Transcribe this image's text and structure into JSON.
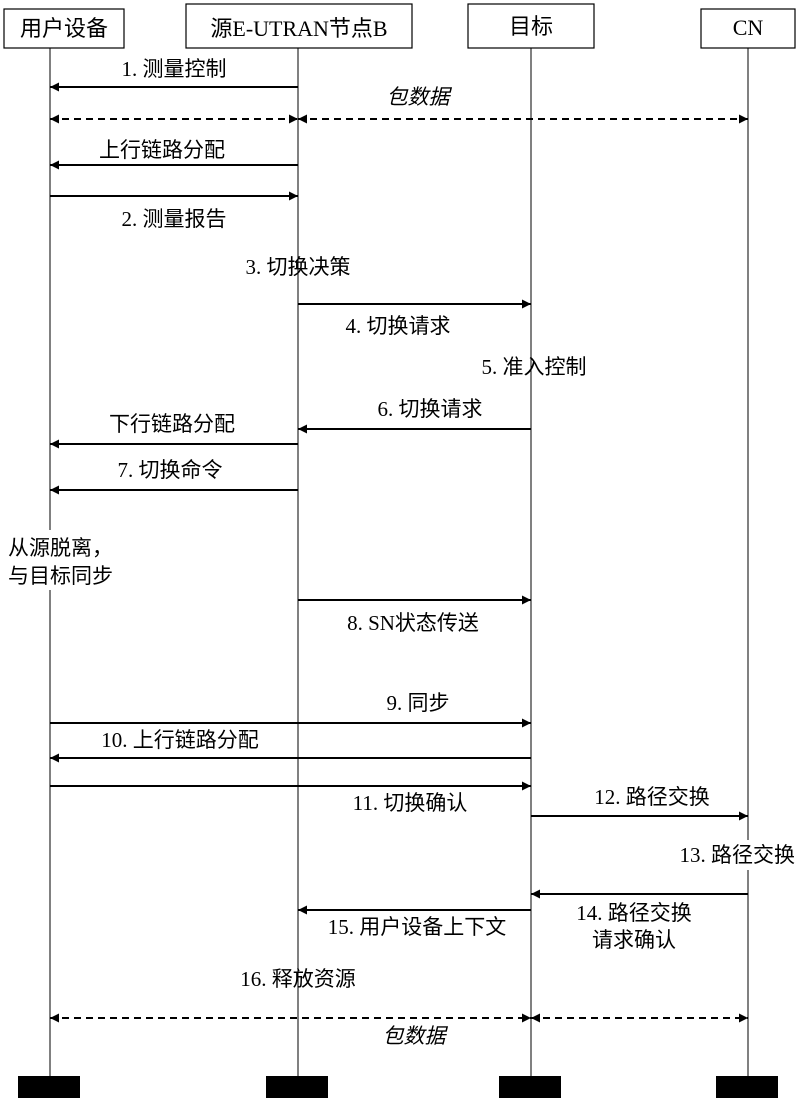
{
  "participants": [
    {
      "id": "ue",
      "label": "用户设备"
    },
    {
      "id": "src",
      "label": "源E-UTRAN节点B"
    },
    {
      "id": "tgt",
      "label": "目标"
    },
    {
      "id": "cn",
      "label": "CN"
    }
  ],
  "messages": [
    {
      "id": "m1",
      "label": "1. 测量控制",
      "from": "src",
      "to": "ue",
      "style": "solid"
    },
    {
      "id": "pd1a",
      "label": "",
      "from": "ue",
      "to": "src",
      "style": "dashed-both"
    },
    {
      "id": "pd1b",
      "label": "包数据",
      "from": "src",
      "to": "cn",
      "style": "dashed-both"
    },
    {
      "id": "ul1",
      "label": "上行链路分配",
      "from": "src",
      "to": "ue",
      "style": "solid"
    },
    {
      "id": "m2",
      "label": "2. 测量报告",
      "from": "ue",
      "to": "src",
      "style": "solid"
    },
    {
      "id": "m4",
      "label": "4. 切换请求",
      "from": "src",
      "to": "tgt",
      "style": "solid"
    },
    {
      "id": "m6",
      "label": "6. 切换请求",
      "from": "tgt",
      "to": "src",
      "style": "solid"
    },
    {
      "id": "dl",
      "label": "下行链路分配",
      "from": "src",
      "to": "ue",
      "style": "solid"
    },
    {
      "id": "m7",
      "label": "7. 切换命令",
      "from": "src",
      "to": "ue",
      "style": "solid"
    },
    {
      "id": "m8",
      "label": "8. SN状态传送",
      "from": "src",
      "to": "tgt",
      "style": "solid"
    },
    {
      "id": "m9",
      "label": "9. 同步",
      "from": "ue",
      "to": "tgt",
      "style": "solid"
    },
    {
      "id": "m10",
      "label": "10. 上行链路分配",
      "from": "tgt",
      "to": "ue",
      "style": "solid"
    },
    {
      "id": "m11",
      "label": "11. 切换确认",
      "from": "ue",
      "to": "tgt",
      "style": "solid"
    },
    {
      "id": "m12",
      "label": "12. 路径交换",
      "from": "tgt",
      "to": "cn",
      "style": "solid"
    },
    {
      "id": "m14",
      "label": "14. 路径交换",
      "label2": "请求确认",
      "from": "cn",
      "to": "tgt",
      "style": "solid"
    },
    {
      "id": "m15",
      "label": "15. 用户设备上下文",
      "from": "tgt",
      "to": "src",
      "style": "solid"
    },
    {
      "id": "pd2a",
      "label": "包数据",
      "from": "ue",
      "to": "tgt",
      "style": "dashed-both"
    },
    {
      "id": "pd2b",
      "label": "",
      "from": "tgt",
      "to": "cn",
      "style": "dashed-both"
    }
  ],
  "notes": [
    {
      "id": "n3",
      "label": "3. 切换决策"
    },
    {
      "id": "n5",
      "label": "5. 准入控制"
    },
    {
      "id": "nd1",
      "label": "从源脱离，"
    },
    {
      "id": "nd2",
      "label": "与目标同步"
    },
    {
      "id": "n13",
      "label": "13. 路径交换"
    },
    {
      "id": "n16",
      "label": "16. 释放资源"
    }
  ]
}
